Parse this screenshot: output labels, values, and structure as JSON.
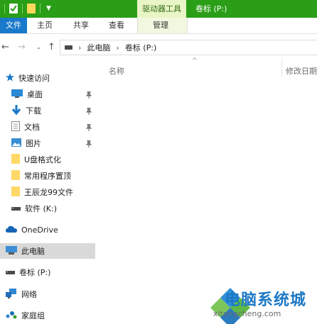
{
  "title_bar": {
    "contextual_tab": "驱动器工具",
    "window_title": "卷标 (P:)"
  },
  "ribbon": {
    "tabs": [
      "文件",
      "主页",
      "共享",
      "查看",
      "管理"
    ]
  },
  "address_bar": {
    "path": [
      "此电脑",
      "卷标 (P:)"
    ]
  },
  "nav_pane": {
    "items": [
      {
        "label": "快速访问",
        "icon": "star-icon"
      },
      {
        "label": "桌面",
        "icon": "desktop-icon",
        "pinned": true
      },
      {
        "label": "下载",
        "icon": "download-icon",
        "pinned": true
      },
      {
        "label": "文档",
        "icon": "document-icon",
        "pinned": true
      },
      {
        "label": "图片",
        "icon": "pictures-icon",
        "pinned": true
      },
      {
        "label": "U盘格式化",
        "icon": "folder-icon"
      },
      {
        "label": "常用程序置顶",
        "icon": "folder-icon"
      },
      {
        "label": "王辰龙99文件",
        "icon": "folder-icon"
      },
      {
        "label": "软件 (K:)",
        "icon": "drive-icon"
      },
      {
        "label": "OneDrive",
        "icon": "cloud-icon"
      },
      {
        "label": "此电脑",
        "icon": "computer-icon",
        "selected": true
      },
      {
        "label": "卷标 (P:)",
        "icon": "drive-icon"
      },
      {
        "label": "网络",
        "icon": "network-icon"
      },
      {
        "label": "家庭组",
        "icon": "homegroup-icon"
      }
    ]
  },
  "file_list": {
    "columns": [
      "名称",
      "修改日期"
    ]
  },
  "watermark": {
    "title": "电脑系统城",
    "url": "xitongcheng.com"
  },
  "colors": {
    "title_bar": "#2a9e16",
    "file_tab": "#1979ca",
    "contextual": "#e9f5c6",
    "selected": "#d9d9d9"
  }
}
